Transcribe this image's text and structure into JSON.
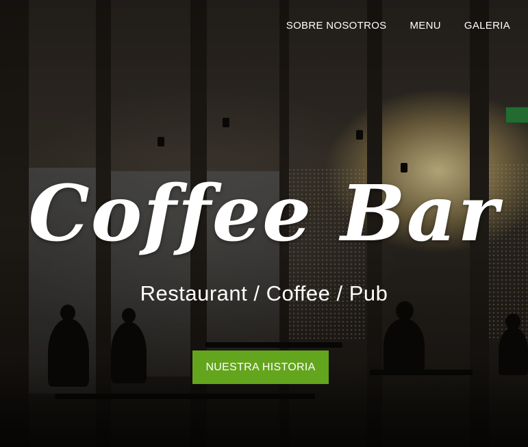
{
  "nav": {
    "items": [
      {
        "label": "SOBRE NOSOTROS"
      },
      {
        "label": "MENU"
      },
      {
        "label": "GALERIA"
      }
    ]
  },
  "hero": {
    "title": "Coffee Bar",
    "subtitle": "Restaurant / Coffee / Pub",
    "cta_label": "NUESTRA HISTORIA"
  },
  "colors": {
    "accent": "#64a51e",
    "text": "#ffffff"
  },
  "background": {
    "image_subject": "restaurant-interior-photo"
  }
}
